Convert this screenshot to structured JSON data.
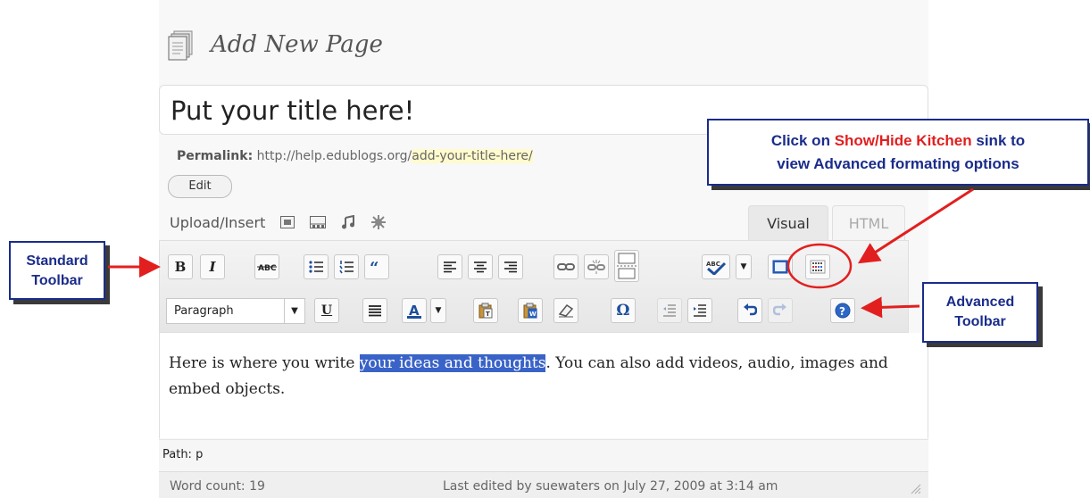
{
  "page": {
    "heading": "Add New Page"
  },
  "title": {
    "value": "Put your title here!"
  },
  "permalink": {
    "label": "Permalink:",
    "url_prefix": "http://help.edublogs.org/",
    "slug": "add-your-title-here/",
    "edit_label": "Edit"
  },
  "upload": {
    "label": "Upload/Insert",
    "icons": [
      "image-icon",
      "video-icon",
      "audio-icon",
      "media-icon"
    ]
  },
  "tabs": {
    "visual": "Visual",
    "html": "HTML"
  },
  "toolbar": {
    "standard": [
      {
        "name": "bold-button",
        "glyph": "B"
      },
      {
        "name": "italic-button",
        "glyph": "I"
      },
      {
        "name": "strikethrough-button",
        "glyph": "ABC"
      },
      {
        "name": "bullet-list-button",
        "glyph": "ul"
      },
      {
        "name": "numbered-list-button",
        "glyph": "ol"
      },
      {
        "name": "blockquote-button",
        "glyph": "“"
      },
      {
        "name": "align-left-button",
        "glyph": "al"
      },
      {
        "name": "align-center-button",
        "glyph": "ac"
      },
      {
        "name": "align-right-button",
        "glyph": "ar"
      },
      {
        "name": "insert-link-button",
        "glyph": "link"
      },
      {
        "name": "unlink-button",
        "glyph": "unlink"
      },
      {
        "name": "insert-more-button",
        "glyph": "more"
      },
      {
        "name": "spellcheck-button",
        "glyph": "ABC"
      },
      {
        "name": "fullscreen-button",
        "glyph": "fs"
      },
      {
        "name": "kitchen-sink-button",
        "glyph": "ks"
      }
    ],
    "advanced": {
      "format_select": "Paragraph",
      "buttons": [
        "underline",
        "justify",
        "text-color",
        "paste-text",
        "paste-word",
        "remove-format",
        "special-character",
        "outdent",
        "indent",
        "undo",
        "redo",
        "help"
      ]
    }
  },
  "editor": {
    "text_before": "Here is where you write ",
    "text_highlight": "your ideas and thoughts",
    "text_after": ".  You can also add videos, audio, images and embed objects."
  },
  "path": {
    "label": "Path: p"
  },
  "status": {
    "word_count": "Word count: 19",
    "last_edited": "Last edited by suewaters on July 27, 2009 at 3:14 am"
  },
  "callouts": {
    "kitchen_line1_a": "Click on ",
    "kitchen_line1_b": "Show/Hide Kitchen",
    "kitchen_line1_c": " sink to",
    "kitchen_line2": "view Advanced formating options",
    "standard_line1": "Standard",
    "standard_line2": "Toolbar",
    "advanced_line1": "Advanced",
    "advanced_line2": "Toolbar"
  },
  "colors": {
    "callout_text": "#1a2c8a",
    "callout_highlight": "#e21f1f",
    "arrow": "#e21f1f",
    "selection": "#3a63c7"
  }
}
